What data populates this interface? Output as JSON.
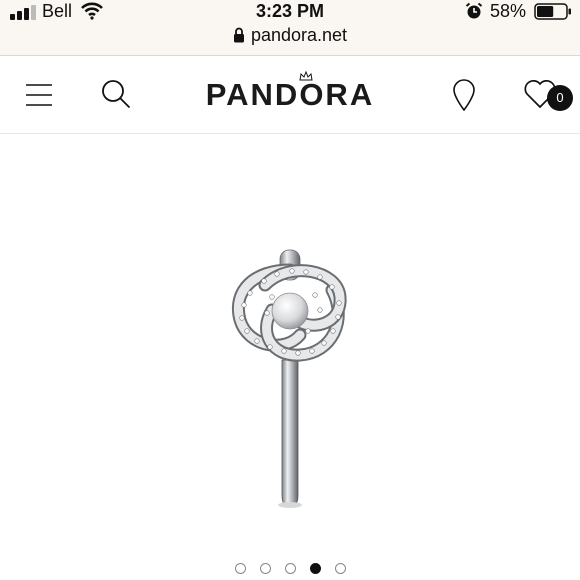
{
  "status_bar": {
    "carrier": "Bell",
    "time": "3:23 PM",
    "battery_percent": "58%",
    "signal_icon": "signal-bars-icon",
    "wifi_icon": "wifi-icon",
    "alarm_icon": "alarm-clock-icon",
    "battery_icon": "battery-icon",
    "battery_level": 0.58
  },
  "address_bar": {
    "url": "pandora.net",
    "lock_icon": "lock-icon"
  },
  "header": {
    "logo_text": "PANDORA",
    "menu_icon": "hamburger-menu-icon",
    "search_icon": "search-icon",
    "store_icon": "location-pin-icon",
    "wishlist_icon": "heart-icon",
    "wishlist_count": "0"
  },
  "product": {
    "image": "silver-ring-with-pearl-and-pave-knot-image"
  },
  "carousel": {
    "total": 5,
    "active_index": 3
  },
  "colors": {
    "topbar_bg": "#faf6f1",
    "text": "#111111",
    "badge_bg": "#111111",
    "metal": "#c9ccd0"
  }
}
